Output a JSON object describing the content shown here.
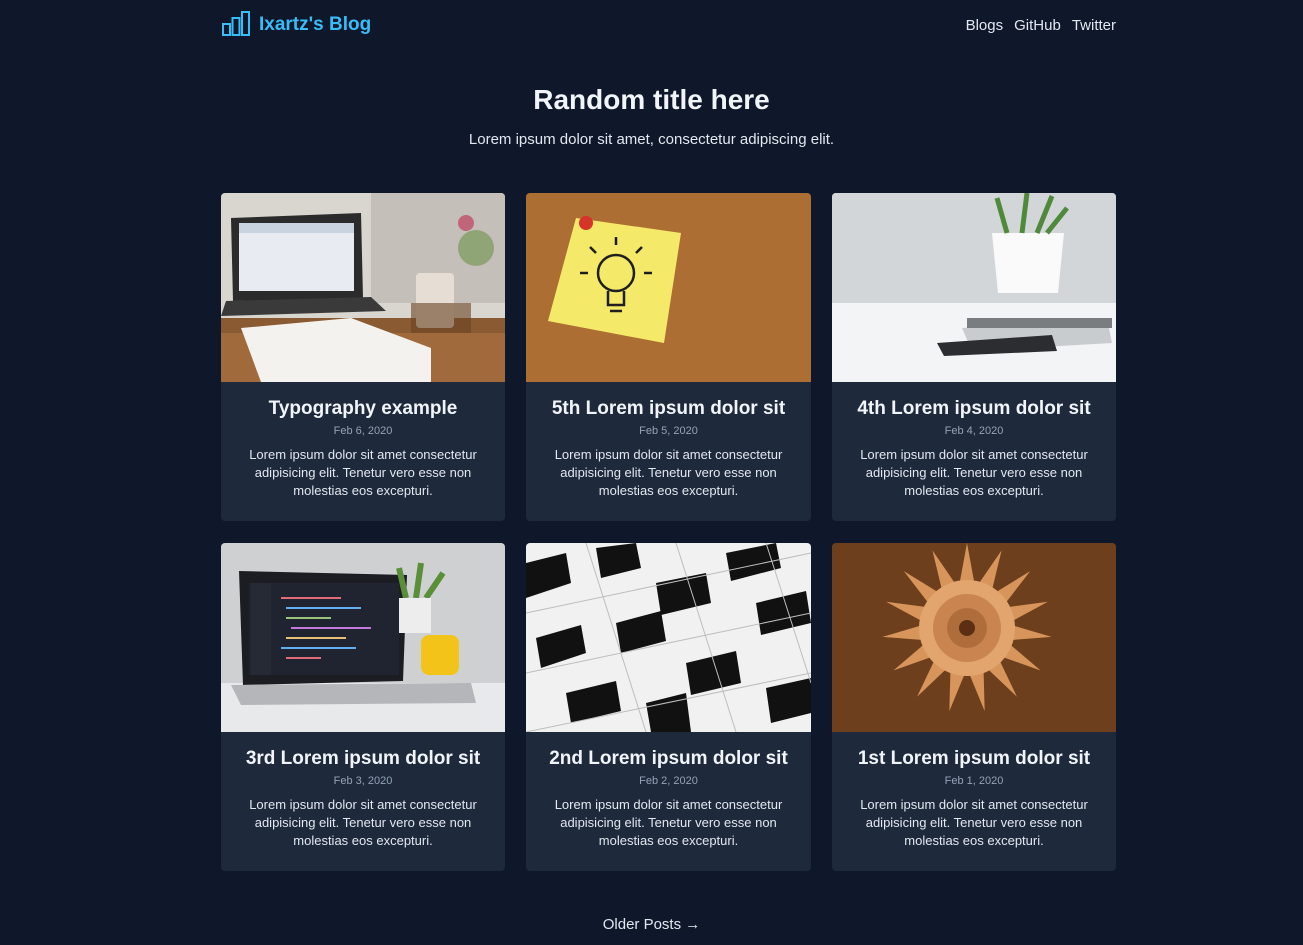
{
  "nav": {
    "brand": "Ixartz's Blog",
    "links": [
      "Blogs",
      "GitHub",
      "Twitter"
    ]
  },
  "hero": {
    "title": "Random title here",
    "subtitle": "Lorem ipsum dolor sit amet, consectetur adipiscing elit."
  },
  "posts": [
    {
      "title": "Typography example",
      "date": "Feb 6, 2020",
      "excerpt": "Lorem ipsum dolor sit amet consectetur adipisicing elit. Tenetur vero esse non molestias eos excepturi.",
      "image": "laptop-desk-photo"
    },
    {
      "title": "5th Lorem ipsum dolor sit",
      "date": "Feb 5, 2020",
      "excerpt": "Lorem ipsum dolor sit amet consectetur adipisicing elit. Tenetur vero esse non molestias eos excepturi.",
      "image": "lightbulb-sticky-note-photo"
    },
    {
      "title": "4th Lorem ipsum dolor sit",
      "date": "Feb 4, 2020",
      "excerpt": "Lorem ipsum dolor sit amet consectetur adipisicing elit. Tenetur vero esse non molestias eos excepturi.",
      "image": "plant-notebook-phone-photo"
    },
    {
      "title": "3rd Lorem ipsum dolor sit",
      "date": "Feb 3, 2020",
      "excerpt": "Lorem ipsum dolor sit amet consectetur adipisicing elit. Tenetur vero esse non molestias eos excepturi.",
      "image": "laptop-code-photo"
    },
    {
      "title": "2nd Lorem ipsum dolor sit",
      "date": "Feb 2, 2020",
      "excerpt": "Lorem ipsum dolor sit amet consectetur adipisicing elit. Tenetur vero esse non molestias eos excepturi.",
      "image": "building-facade-photo"
    },
    {
      "title": "1st Lorem ipsum dolor sit",
      "date": "Feb 1, 2020",
      "excerpt": "Lorem ipsum dolor sit amet consectetur adipisicing elit. Tenetur vero esse non molestias eos excepturi.",
      "image": "paper-flower-photo"
    }
  ],
  "older_posts": "Older Posts →",
  "colors": {
    "background": "#0f172a",
    "card": "#1e293b",
    "brand": "#38bdf8"
  }
}
